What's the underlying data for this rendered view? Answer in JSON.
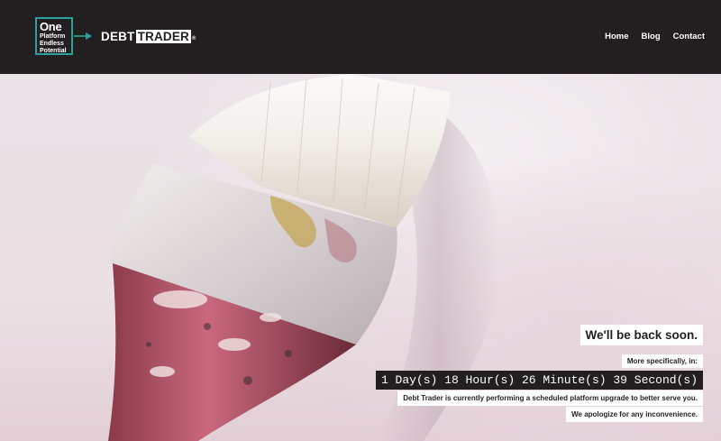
{
  "header": {
    "logo_line1": "One",
    "logo_line2": "Platform",
    "logo_line3": "Endless",
    "logo_line4": "Potential",
    "wordmark_left": "DEBT",
    "wordmark_right": "TRADER",
    "wordmark_mark": "®",
    "accent_color": "#2aa39a",
    "background_color": "#231f20"
  },
  "nav": {
    "items": [
      {
        "label": "Home"
      },
      {
        "label": "Blog"
      },
      {
        "label": "Contact"
      }
    ]
  },
  "maintenance": {
    "title": "We'll be back soon.",
    "subtitle": "More specifically, in:",
    "countdown": "1 Day(s) 18 Hour(s) 26 Minute(s) 39 Second(s)",
    "line1": "Debt Trader is currently performing a scheduled platform upgrade to better serve you.",
    "line2": "We apologize for any inconvenience."
  },
  "hero": {
    "image": "paintbrush-icon"
  }
}
